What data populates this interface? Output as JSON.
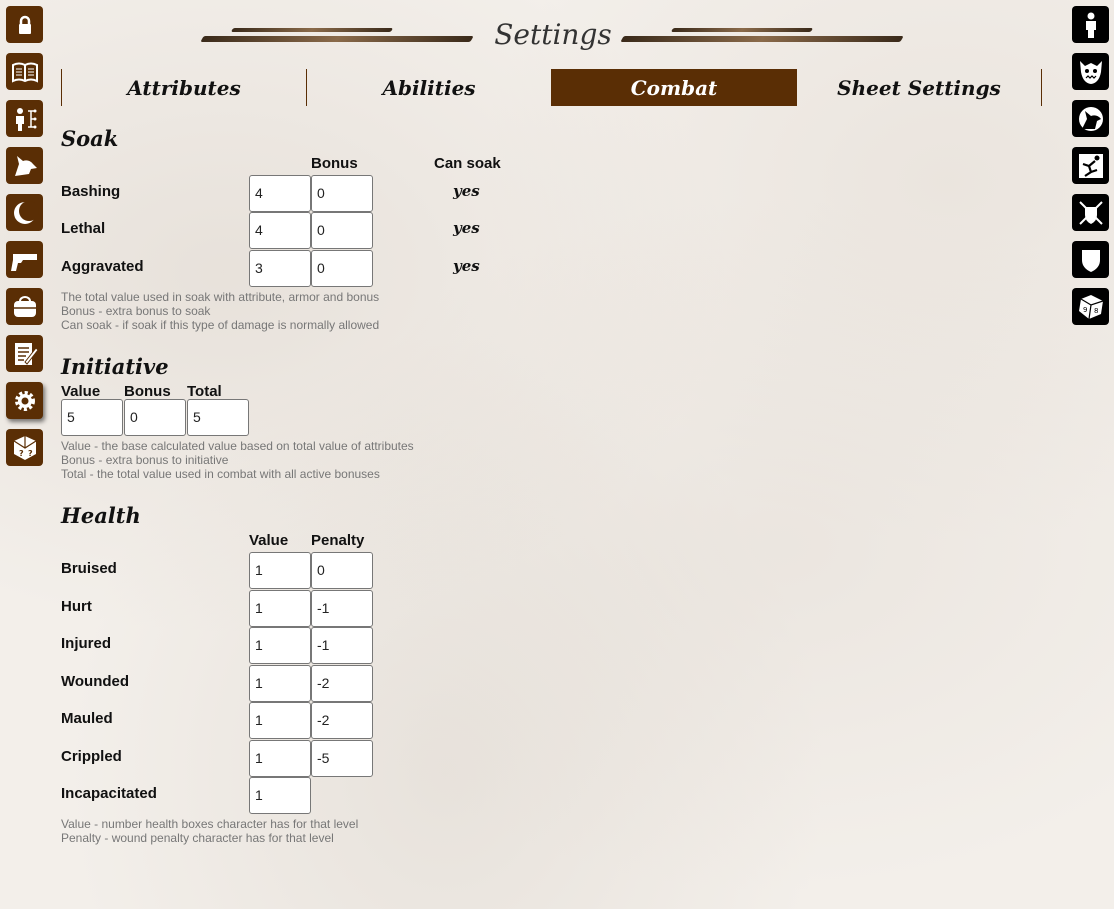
{
  "banner": {
    "title": "Settings"
  },
  "tabs": [
    {
      "label": "Attributes",
      "active": false
    },
    {
      "label": "Abilities",
      "active": false
    },
    {
      "label": "Combat",
      "active": true
    },
    {
      "label": "Sheet Settings",
      "active": false
    }
  ],
  "left_sidebar": [
    {
      "icon": "lock-icon"
    },
    {
      "icon": "book-icon"
    },
    {
      "icon": "character-tree-icon"
    },
    {
      "icon": "wolf-head-icon"
    },
    {
      "icon": "moon-icon"
    },
    {
      "icon": "pistol-icon"
    },
    {
      "icon": "bag-icon"
    },
    {
      "icon": "notes-icon"
    },
    {
      "icon": "gear-icon",
      "active": true
    },
    {
      "icon": "dice-question-icon"
    }
  ],
  "right_sidebar": [
    {
      "icon": "person-icon"
    },
    {
      "icon": "monster-face-icon"
    },
    {
      "icon": "wolf-howl-icon"
    },
    {
      "icon": "acrobat-icon"
    },
    {
      "icon": "crossed-swords-shield-icon"
    },
    {
      "icon": "shield-icon"
    },
    {
      "icon": "dice-icon"
    }
  ],
  "soak": {
    "title": "Soak",
    "bonus_header": "Bonus",
    "can_soak_header": "Can soak",
    "rows": [
      {
        "label": "Bashing",
        "value": "4",
        "bonus": "0",
        "can_soak": "yes"
      },
      {
        "label": "Lethal",
        "value": "4",
        "bonus": "0",
        "can_soak": "yes"
      },
      {
        "label": "Aggravated",
        "value": "3",
        "bonus": "0",
        "can_soak": "yes"
      }
    ],
    "notes": [
      "The total value used in soak with attribute, armor and bonus",
      "Bonus - extra bonus to soak",
      "Can soak - if soak if this type of damage is normally allowed"
    ]
  },
  "initiative": {
    "title": "Initiative",
    "value_header": "Value",
    "bonus_header": "Bonus",
    "total_header": "Total",
    "value": "5",
    "bonus": "0",
    "total": "5",
    "notes": [
      "Value - the base calculated value based on total value of attributes",
      "Bonus - extra bonus to initiative",
      "Total - the total value used in combat with all active bonuses"
    ]
  },
  "health": {
    "title": "Health",
    "value_header": "Value",
    "penalty_header": "Penalty",
    "rows": [
      {
        "label": "Bruised",
        "value": "1",
        "penalty": "0"
      },
      {
        "label": "Hurt",
        "value": "1",
        "penalty": "-1"
      },
      {
        "label": "Injured",
        "value": "1",
        "penalty": "-1"
      },
      {
        "label": "Wounded",
        "value": "1",
        "penalty": "-2"
      },
      {
        "label": "Mauled",
        "value": "1",
        "penalty": "-2"
      },
      {
        "label": "Crippled",
        "value": "1",
        "penalty": "-5"
      },
      {
        "label": "Incapacitated",
        "value": "1"
      }
    ],
    "notes": [
      "Value - number health boxes character has for that level",
      "Penalty - wound penalty character has for that level"
    ]
  }
}
